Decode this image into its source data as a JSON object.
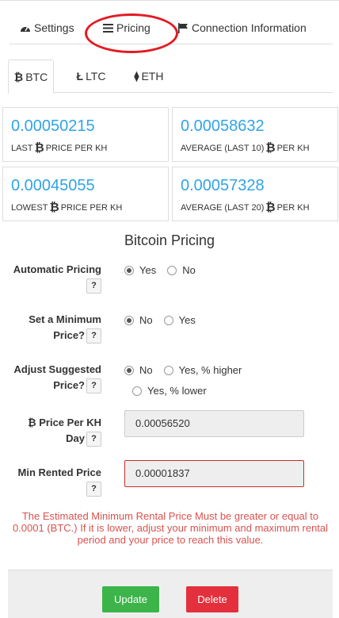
{
  "main_tabs": {
    "settings": "Settings",
    "pricing": "Pricing",
    "connection": "Connection Information"
  },
  "currency_tabs": {
    "btc": "BTC",
    "ltc": "LTC",
    "eth": "ETH"
  },
  "stats": {
    "last_price": {
      "value": "0.00050215",
      "label_a": "LAST",
      "label_b": "PRICE PER KH"
    },
    "avg10": {
      "value": "0.00058632",
      "label_a": "AVERAGE (LAST 10)",
      "label_b": "PER KH"
    },
    "lowest": {
      "value": "0.00045055",
      "label_a": "LOWEST",
      "label_b": "PRICE PER KH"
    },
    "avg20": {
      "value": "0.00057328",
      "label_a": "AVERAGE (LAST 20)",
      "label_b": "PER KH"
    }
  },
  "section_title": "Bitcoin Pricing",
  "form": {
    "automatic_pricing": {
      "label": "Automatic Pricing",
      "options": [
        "Yes",
        "No"
      ],
      "selected": "Yes"
    },
    "min_price": {
      "label_1": "Set a Minimum",
      "label_2": "Price?",
      "options": [
        "No",
        "Yes"
      ],
      "selected": "No"
    },
    "adjust": {
      "label_1": "Adjust Suggested",
      "label_2": "Price?",
      "options": [
        "No",
        "Yes, % higher",
        "Yes, % lower"
      ],
      "selected": "No"
    },
    "price_per_kh": {
      "label_1": "Price Per KH",
      "label_2": "Day",
      "value": "0.00056520"
    },
    "min_rented": {
      "label": "Min Rented Price",
      "value": "0.00001837"
    },
    "help": "?"
  },
  "error": "The Estimated Minimum Rental Price Must be greater or equal to 0.0001 (BTC.) If it is lower, adjust your minimum and maximum rental period and your price to reach this value.",
  "buttons": {
    "update": "Update",
    "delete": "Delete"
  },
  "symbols": {
    "btc": "₿",
    "ltc": "Ł",
    "eth": "⧫"
  },
  "colors": {
    "accent": "#2fa4e7",
    "success": "#3cb44a",
    "danger": "#e3303c",
    "error_text": "#d9534f",
    "highlight_oval": "#e31b23"
  }
}
